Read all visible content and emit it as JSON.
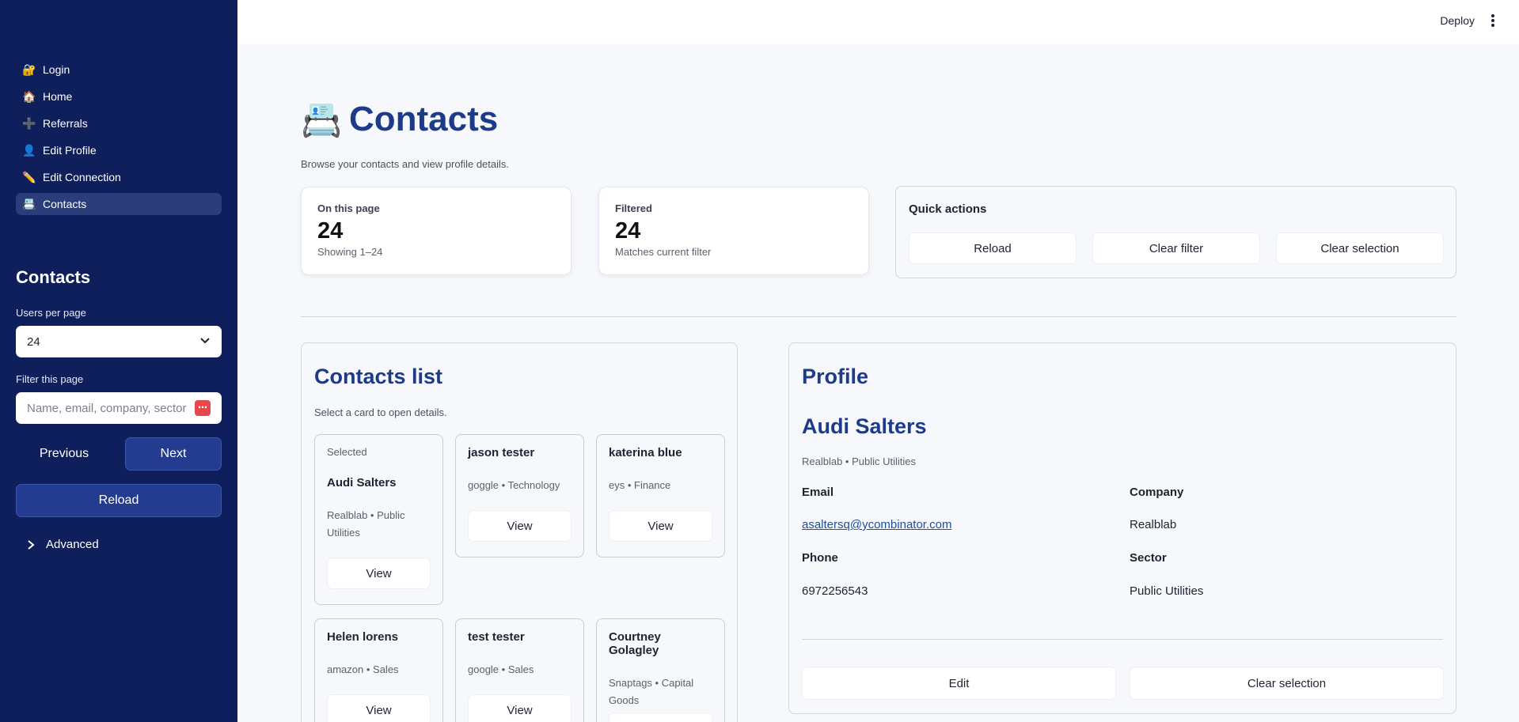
{
  "sidebar": {
    "nav": [
      {
        "icon": "🔐",
        "icon_name": "lock-key-icon",
        "label": "Login"
      },
      {
        "icon": "🏠",
        "icon_name": "house-icon",
        "label": "Home"
      },
      {
        "icon": "➕",
        "icon_name": "plus-icon",
        "label": "Referrals"
      },
      {
        "icon": "👤",
        "icon_name": "user-icon",
        "label": "Edit Profile"
      },
      {
        "icon": "✏️",
        "icon_name": "pencil-icon",
        "label": "Edit Connection"
      },
      {
        "icon": "📇",
        "icon_name": "card-index-icon",
        "label": "Contacts"
      }
    ],
    "active_nav": "Contacts",
    "heading": "Contacts",
    "users_per_page_label": "Users per page",
    "users_per_page_value": "24",
    "filter_label": "Filter this page",
    "filter_placeholder": "Name, email, company, sector",
    "filter_value": "",
    "previous_label": "Previous",
    "next_label": "Next",
    "reload_label": "Reload",
    "advanced_label": "Advanced"
  },
  "topbar": {
    "deploy_label": "Deploy"
  },
  "page": {
    "icon": "📇",
    "title": "Contacts",
    "subtitle": "Browse your contacts and view profile details."
  },
  "metrics": [
    {
      "label": "On this page",
      "value": "24",
      "sub": "Showing 1–24"
    },
    {
      "label": "Filtered",
      "value": "24",
      "sub": "Matches current filter"
    }
  ],
  "quick_actions": {
    "title": "Quick actions",
    "buttons": [
      "Reload",
      "Clear filter",
      "Clear selection"
    ]
  },
  "contacts_list": {
    "title": "Contacts list",
    "subtitle": "Select a card to open details.",
    "selected_tag": "Selected",
    "view_label": "View",
    "cards": [
      {
        "name": "Audi Salters",
        "meta": "Realblab • Public Utilities",
        "selected": true
      },
      {
        "name": "jason tester",
        "meta": "goggle • Technology",
        "selected": false
      },
      {
        "name": "katerina blue",
        "meta": "eys • Finance",
        "selected": false
      },
      {
        "name": "Helen lorens",
        "meta": "amazon • Sales",
        "selected": false
      },
      {
        "name": "test tester",
        "meta": "google • Sales",
        "selected": false
      },
      {
        "name": "Courtney Golagley",
        "meta": "Snaptags • Capital Goods",
        "selected": false
      }
    ]
  },
  "profile": {
    "title": "Profile",
    "name": "Audi Salters",
    "meta": "Realblab • Public Utilities",
    "email_label": "Email",
    "email": "asaltersq@ycombinator.com",
    "company_label": "Company",
    "company": "Realblab",
    "phone_label": "Phone",
    "phone": "6972256543",
    "sector_label": "Sector",
    "sector": "Public Utilities",
    "edit_label": "Edit",
    "clear_selection_label": "Clear selection"
  }
}
